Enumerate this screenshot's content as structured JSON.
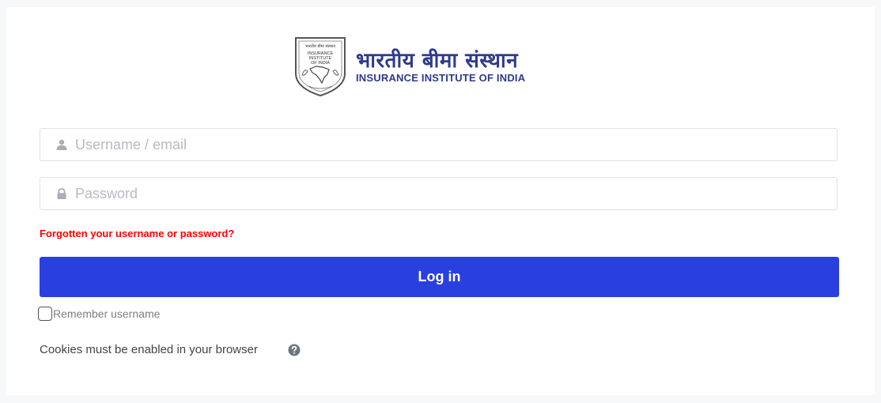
{
  "logo": {
    "hindi_name": "भारतीय बीमा संस्थान",
    "english_name": "INSURANCE INSTITUTE OF INDIA",
    "emblem_text": [
      "भारतीय बीमा संस्थान",
      "INSURANCE",
      "INSTITUTE",
      "OF INDIA"
    ]
  },
  "form": {
    "username": {
      "placeholder": "Username / email",
      "value": "",
      "icon": "user-icon"
    },
    "password": {
      "placeholder": "Password",
      "value": "",
      "icon": "lock-icon"
    },
    "forgot_link": "Forgotten your username or password?",
    "login_button": "Log in",
    "remember_label": "Remember username",
    "remember_checked": false,
    "cookies_notice": "Cookies must be enabled in your browser",
    "help_icon": "question-circle-icon"
  },
  "colors": {
    "accent": "#2a3fe0",
    "link_red": "#ff0000",
    "brand_navy": "#2e3a8c"
  }
}
